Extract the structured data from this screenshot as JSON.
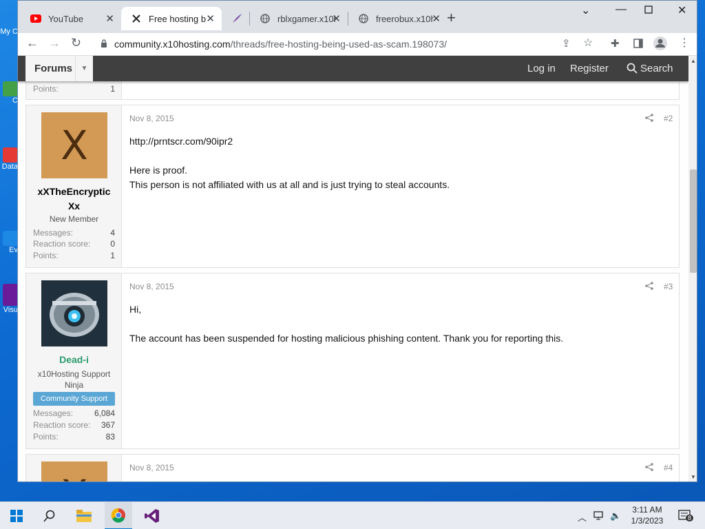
{
  "desktop": {
    "icons": [
      {
        "label": "My C",
        "color": "#2e7d32"
      },
      {
        "label": "C",
        "color": "#43a047"
      },
      {
        "label": "Data",
        "color": "#e53935"
      },
      {
        "label": "Ev",
        "color": "#1e88e5"
      },
      {
        "label": "Visu",
        "color": "#6a1b9a"
      }
    ]
  },
  "browser": {
    "tabs": [
      {
        "title": "YouTube",
        "icon": "youtube-icon",
        "color": "#ff0000"
      },
      {
        "title": "Free hosting b",
        "icon": "x10-icon",
        "active": true
      },
      {
        "title": "",
        "icon": "feather-icon",
        "color": "#7b4fa8"
      },
      {
        "title": "rblxgamer.x10h",
        "icon": "globe-icon"
      },
      {
        "title": "freerobux.x10h",
        "icon": "globe-icon"
      }
    ],
    "url_host": "community.x10hosting.com",
    "url_path": "/threads/free-hosting-being-used-as-scam.198073/"
  },
  "navbar": {
    "forums_label": "Forums",
    "login_label": "Log in",
    "register_label": "Register",
    "search_label": "Search"
  },
  "previous_post_tail": {
    "points_label": "Points:",
    "points": "1"
  },
  "posts": [
    {
      "date": "Nov 8, 2015",
      "number": "#2",
      "user": {
        "avatar_letter": "X",
        "name_line1": "xXTheEncryptic",
        "name_line2": "Xx",
        "title": "New Member",
        "messages_label": "Messages:",
        "messages": "4",
        "reaction_label": "Reaction score:",
        "reaction": "0",
        "points_label": "Points:",
        "points": "1"
      },
      "lines": [
        "http://prntscr.com/90ipr2",
        "",
        "Here is proof.",
        "This person is not affiliated with us at all and is just trying to steal accounts."
      ]
    },
    {
      "date": "Nov 8, 2015",
      "number": "#3",
      "user": {
        "name": "Dead-i",
        "title_line1": "x10Hosting Support",
        "title_line2": "Ninja",
        "banner": "Community Support",
        "messages_label": "Messages:",
        "messages": "6,084",
        "reaction_label": "Reaction score:",
        "reaction": "367",
        "points_label": "Points:",
        "points": "83"
      },
      "lines": [
        "Hi,",
        "",
        "The account has been suspended for hosting malicious phishing content. Thank you for reporting this."
      ]
    },
    {
      "date": "Nov 8, 2015",
      "number": "#4",
      "user": {
        "avatar_letter": "X"
      }
    }
  ],
  "taskbar": {
    "time": "3:11 AM",
    "date": "1/3/2023",
    "notifications": "8"
  }
}
